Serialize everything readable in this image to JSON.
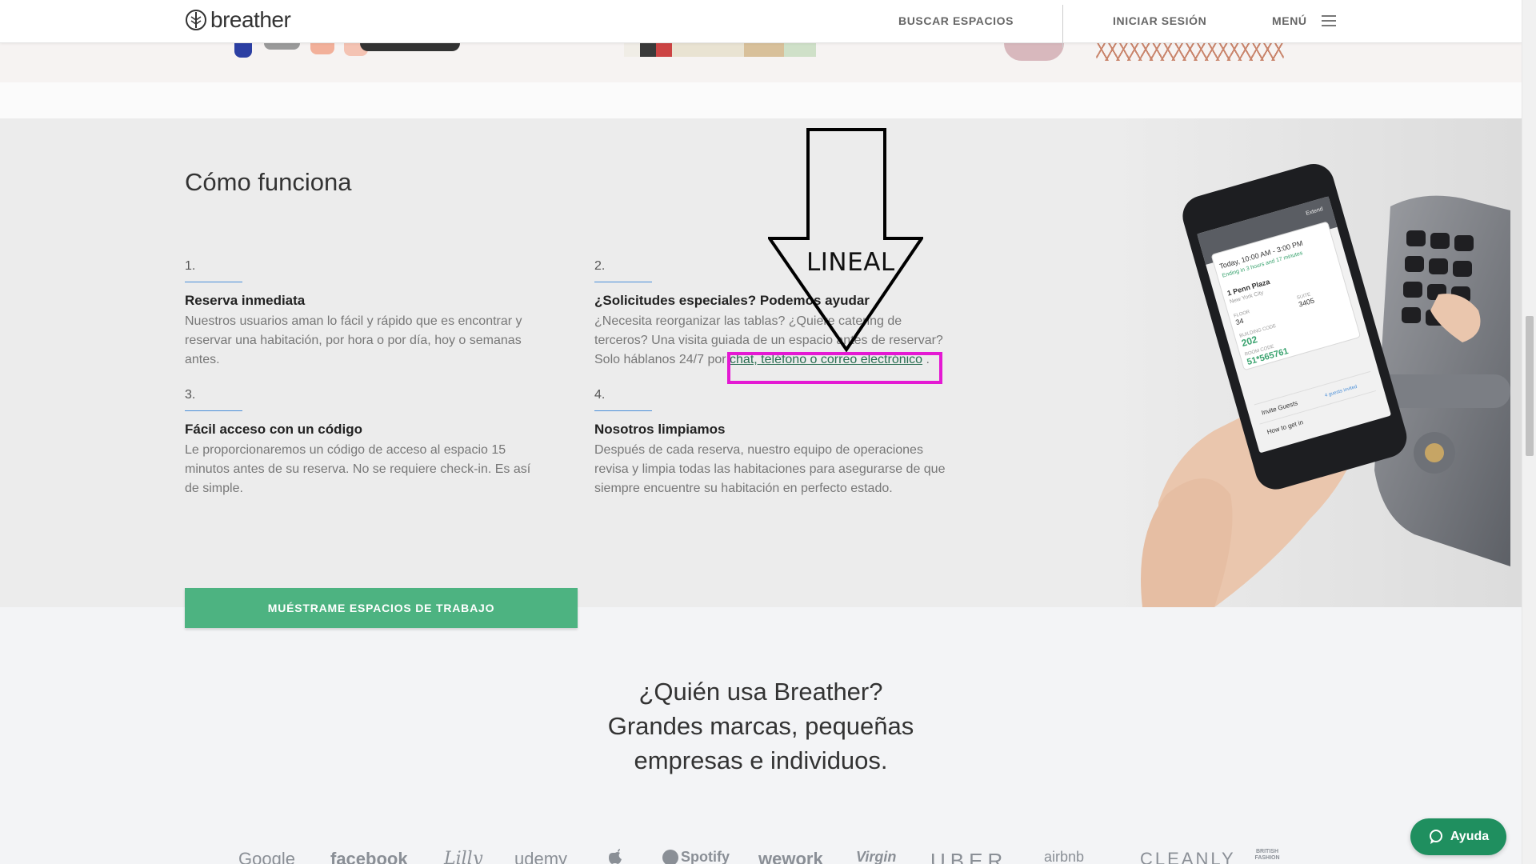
{
  "header": {
    "logo_text": "breather",
    "nav": {
      "search": "BUSCAR ESPACIOS",
      "login": "INICIAR SESIÓN",
      "menu": "MENÚ"
    }
  },
  "how_it_works": {
    "title": "Cómo funciona",
    "steps": [
      {
        "number": "1.",
        "title": "Reserva inmediata",
        "text": "Nuestros usuarios aman lo fácil y rápido que es encontrar y reservar una habitación, por hora o por día, hoy o semanas antes."
      },
      {
        "number": "2.",
        "title": "¿Solicitudes especiales? Podemos ayudar",
        "text": "¿Necesita reorganizar las tablas? ¿Quiere catering de terceros? Una visita guiada de un espacio antes de reservar? Solo háblanos 24/7 por",
        "link": "chat, teléfono o correo electrónico",
        "text_end": " ."
      },
      {
        "number": "3.",
        "title": "Fácil acceso con un código",
        "text": "Le proporcionaremos un código de acceso al espacio 15 minutos antes de su reserva. No se requiere check-in. Es así de simple."
      },
      {
        "number": "4.",
        "title": "Nosotros limpiamos",
        "text": "Después de cada reserva, nuestro equipo de operaciones revisa y limpia todas las habitaciones para asegurarse de que siempre encuentre su habitación en perfecto estado."
      }
    ],
    "cta": "MUÉSTRAME ESPACIOS DE TRABAJO",
    "phone_screen": {
      "time": "Today, 10:00 AM - 3:00 PM",
      "sub": "Ending in 3 hours and 17 minutes",
      "place": "1 Penn Plaza",
      "city": "New York City",
      "floor_label": "FLOOR",
      "floor": "34",
      "suite_label": "SUITE",
      "suite": "3405",
      "building_label": "BUILDING CODE",
      "building": "202",
      "room_label": "ROOM CODE",
      "room": "51*565761",
      "invite": "Invite Guests",
      "invited": "4 guests invited",
      "how": "How to get in",
      "extend": "Extend"
    }
  },
  "who": {
    "line1": "¿Quién usa Breather?",
    "line2": "Grandes marcas, pequeñas",
    "line3": "empresas e individuos.",
    "brands": [
      "Google",
      "facebook",
      "Lilly",
      "udemy",
      "",
      "Spotify",
      "wework",
      "Virgin",
      "UBER",
      "airbnb",
      "CLEANLY",
      "BRITISH FASHION"
    ]
  },
  "help": {
    "label": "Ayuda"
  },
  "annotation": {
    "label": "LINEAL",
    "box_color": "#e419d3"
  }
}
